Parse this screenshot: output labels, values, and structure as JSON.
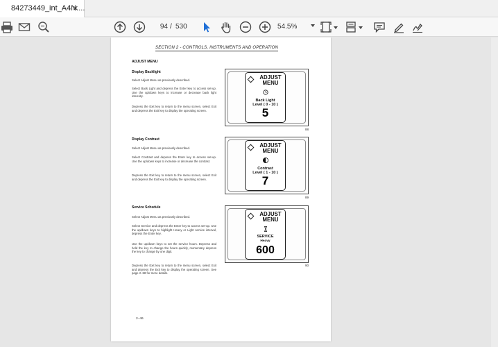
{
  "tab": {
    "title": "84273449_int_A4N....",
    "close_glyph": "×"
  },
  "toolbar": {
    "page_current": "94",
    "page_separator": "/",
    "page_total": "530",
    "zoom": "54.5%"
  },
  "document": {
    "section_title": "SECTION 2  -  CONTROLS, INSTRUMENTS AND OPERATION",
    "heading": "ADJUST MENU",
    "page_footer": "2–46",
    "sections": [
      {
        "subtitle": "Display Backlight",
        "paragraphs": [
          "Select Adjust Menu as previously described.",
          "Select Back Light and depress the Enter key to access set-up. Use the up/down keys to increase or decrease back light intensity.",
          "Depress the Exit key to return to the menu screen, select Exit and depress the Exit key to display the operating screen."
        ],
        "screen": {
          "title_line1": "ADJUST",
          "title_line2": "MENU",
          "label_line1": "Back Light",
          "label_line2": "Level ( 0 - 10 )",
          "value": "5",
          "icon": "sun-icon"
        },
        "figure": "88"
      },
      {
        "subtitle": "Display Contrast",
        "paragraphs": [
          "Select Adjust Menu as previously described.",
          "Select Contrast and depress the Enter key to access set-up. Use the up/down keys to increase or decrease the contrast.",
          "Depress the Exit key to return to the menu screen, select Exit and depress the Exit key to display the operating screen."
        ],
        "screen": {
          "title_line1": "ADJUST",
          "title_line2": "MENU",
          "label_line1": "Contrast",
          "label_line2": "Level ( 1 - 10 )",
          "value": "7",
          "icon": "contrast-icon"
        },
        "figure": "89"
      },
      {
        "subtitle": "Service Schedule",
        "paragraphs": [
          "Select Adjust Menu as previously described.",
          "Select Service and depress the Enter key to access set-up. Use the up/down keys to highlight Heavy or Light service interval, depress the Enter key.",
          "Use the up/down keys to set the service hours. Depress and hold the key to change the hours quickly, momentary depress the key to change by one digit.",
          "Depress the Exit key to return to the menu screen, select Exit and depress the Exit key to display the operating screen. See page 2–58 for more details."
        ],
        "screen": {
          "title_line1": "ADJUST",
          "title_line2": "MENU",
          "label_line1": "SERVICE",
          "label_line2": "Heavy",
          "value": "600",
          "icon": "hourglass-icon"
        },
        "figure": "90"
      }
    ]
  },
  "colors": {
    "toolbar_bg": "#f7f7f7",
    "canvas_bg": "#e6e6e6",
    "cursor_blue": "#1f6fd6"
  }
}
